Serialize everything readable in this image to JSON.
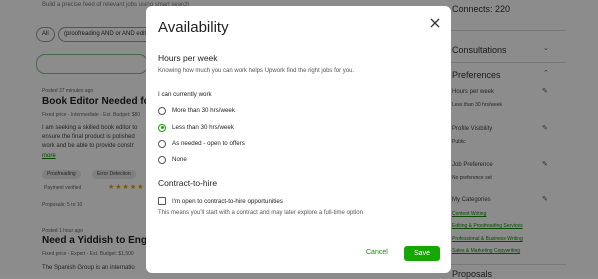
{
  "background": {
    "search_hint": "Build a precise feed of relevant jobs using smart search",
    "filter_chips": [
      "All",
      "(proofreading AND or AND editing)"
    ],
    "jobs": [
      {
        "posted": "Posted 37 minutes ago",
        "title": "Book Editor Needed for Firs",
        "meta": "Fixed price - Intermediate - Est. Budget: $80",
        "description": [
          "I am seeking a skilled book editor to",
          "ensure the final product is polished",
          "work and be able to provide constr"
        ],
        "more": "more",
        "tags": [
          "Proofreading",
          "Error Detection"
        ],
        "payment": "Payment verified",
        "stars": "★★★★★",
        "proposals": "Proposals: 5 to 10"
      },
      {
        "posted": "Posted 1 hour ago",
        "title": "Need a Yiddish to English Tr",
        "meta": "Fixed price - Expert - Est. Budget: $1,500",
        "description": [
          "The Spanish Group is an internatio"
        ]
      }
    ],
    "right": {
      "connects": "Connects: 220",
      "consultations": "Consultations",
      "preferences": "Preferences",
      "hours_label": "Hours per week",
      "hours_value": "Less than 30 hrs/week",
      "profile_visibility": "Profile Visibility",
      "profile_value": "Public",
      "job_preference": "Job Preference",
      "job_pref_value": "No preference set",
      "my_categories": "My Categories",
      "categories": [
        "Content Writing",
        "Editing & Proofreading Services",
        "Professional & Business Writing",
        "Sales & Marketing Copywriting"
      ],
      "proposals": "Proposals"
    }
  },
  "modal": {
    "title": "Availability",
    "hours_heading": "Hours per week",
    "hours_subtitle": "Knowing how much you can work helps Upwork find the right jobs for you.",
    "currently_label": "I can currently work",
    "options": [
      {
        "label": "More than 30 hrs/week",
        "checked": false
      },
      {
        "label": "Less than 30 hrs/week",
        "checked": true
      },
      {
        "label": "As needed - open to offers",
        "checked": false
      },
      {
        "label": "None",
        "checked": false
      }
    ],
    "contract_heading": "Contract-to-hire",
    "contract_checkbox": "I'm open to contract-to-hire opportunities",
    "contract_note": "This means you'll start with a contract and may later explore a full-time option",
    "cancel": "Cancel",
    "save": "Save"
  },
  "colors": {
    "accent": "#14a800",
    "link": "#108a00",
    "overlay": "rgba(0,0,0,0.45)"
  },
  "icons": {
    "close": "close-icon",
    "edit": "pencil-icon",
    "chevron": "chevron-down-icon"
  }
}
